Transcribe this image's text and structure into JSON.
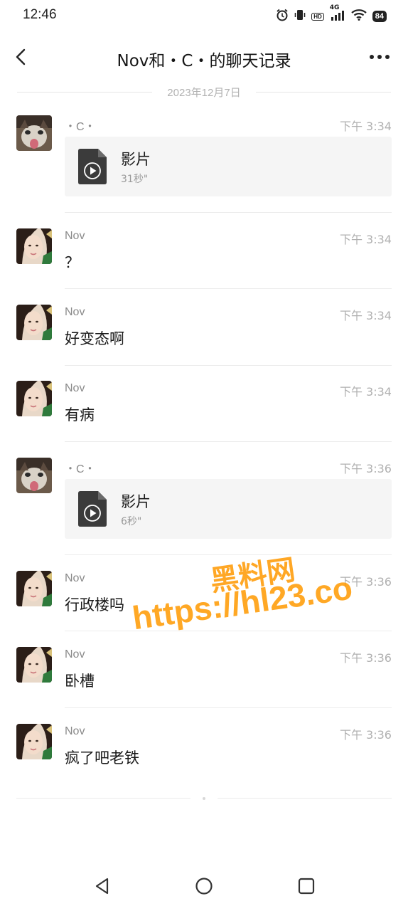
{
  "status_bar": {
    "time": "12:46",
    "network": "4G",
    "hd": "HD",
    "battery": "84"
  },
  "header": {
    "title": "Nov和・C・的聊天记录"
  },
  "date_divider": "2023年12月7日",
  "messages": [
    {
      "sender": "・C・",
      "time": "下午 3:34",
      "type": "video",
      "video_label": "影片",
      "duration": "31秒\"",
      "avatar": "cat"
    },
    {
      "sender": "Nov",
      "time": "下午 3:34",
      "type": "text",
      "text": "？",
      "avatar": "girl"
    },
    {
      "sender": "Nov",
      "time": "下午 3:34",
      "type": "text",
      "text": "好变态啊",
      "avatar": "girl"
    },
    {
      "sender": "Nov",
      "time": "下午 3:34",
      "type": "text",
      "text": "有病",
      "avatar": "girl"
    },
    {
      "sender": "・C・",
      "time": "下午 3:36",
      "type": "video",
      "video_label": "影片",
      "duration": "6秒\"",
      "avatar": "cat"
    },
    {
      "sender": "Nov",
      "time": "下午 3:36",
      "type": "text",
      "text": "行政楼吗",
      "avatar": "girl"
    },
    {
      "sender": "Nov",
      "time": "下午 3:36",
      "type": "text",
      "text": "卧槽",
      "avatar": "girl"
    },
    {
      "sender": "Nov",
      "time": "下午 3:36",
      "type": "text",
      "text": "疯了吧老铁",
      "avatar": "girl"
    }
  ],
  "watermark": {
    "line1": "黑料网",
    "line2": "https://hl23.co"
  },
  "colors": {
    "watermark": "#ff9800",
    "card_bg": "#f5f5f5",
    "muted_text": "#b0b0b0"
  }
}
